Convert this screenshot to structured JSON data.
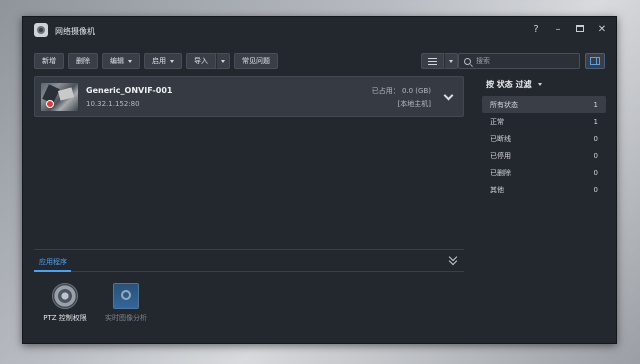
{
  "window": {
    "title": "网络摄像机",
    "controls": {
      "help": "?",
      "minimize": "–",
      "close": "✕"
    }
  },
  "toolbar": {
    "add": "新增",
    "delete": "删除",
    "edit": "编辑",
    "enable": "启用",
    "import": "导入",
    "faq": "常见问题"
  },
  "search": {
    "placeholder": "搜索"
  },
  "camera": {
    "name": "Generic_ONVIF-001",
    "ip": "10.32.1.152:80",
    "usage": "已占用： 0.0 (GB)",
    "host": "[本地主机]"
  },
  "apps": {
    "tab_label": "应用程序",
    "items": [
      {
        "label": "PTZ 控制权限",
        "icon": "ptz-icon",
        "enabled": true
      },
      {
        "label": "实时图像分析",
        "icon": "video-analytics-icon",
        "enabled": false
      }
    ]
  },
  "filter": {
    "title": "按 状态 过滤",
    "items": [
      {
        "label": "所有状态",
        "count": "1",
        "selected": true
      },
      {
        "label": "正常",
        "count": "1"
      },
      {
        "label": "已断线",
        "count": "0"
      },
      {
        "label": "已停用",
        "count": "0"
      },
      {
        "label": "已删除",
        "count": "0"
      },
      {
        "label": "其他",
        "count": "0"
      }
    ]
  },
  "colors": {
    "accent": "#4ea1f0",
    "recording": "#e23b3b",
    "window_bg": "#23272e"
  }
}
